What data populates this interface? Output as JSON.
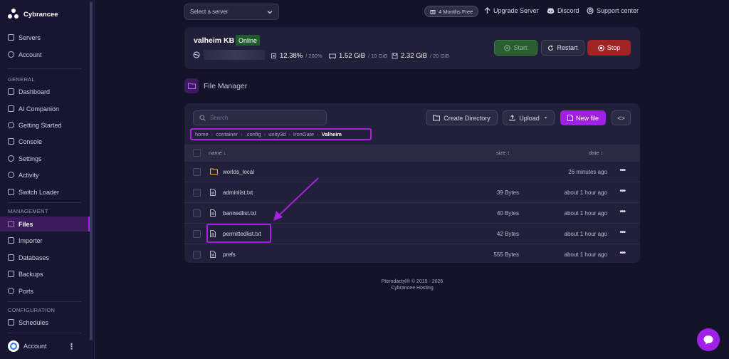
{
  "sidebar": {
    "brand": "Cybrancee",
    "top_items": [
      {
        "label": "Servers",
        "icon": "servers-icon"
      },
      {
        "label": "Account",
        "icon": "account-icon"
      }
    ],
    "section_general": "GENERAL",
    "general_items": [
      {
        "label": "Dashboard",
        "icon": "dashboard-icon"
      },
      {
        "label": "AI Companion",
        "icon": "ai-icon"
      },
      {
        "label": "Getting Started",
        "icon": "getting-started-icon"
      },
      {
        "label": "Console",
        "icon": "console-icon"
      },
      {
        "label": "Settings",
        "icon": "settings-icon"
      },
      {
        "label": "Activity",
        "icon": "activity-icon"
      },
      {
        "label": "Switch Loader",
        "icon": "switch-icon"
      }
    ],
    "section_management": "MANAGEMENT",
    "management_items": [
      {
        "label": "Files",
        "icon": "folder-icon",
        "active": true
      },
      {
        "label": "Importer",
        "icon": "import-icon"
      },
      {
        "label": "Databases",
        "icon": "database-icon"
      },
      {
        "label": "Backups",
        "icon": "backup-icon"
      },
      {
        "label": "Ports",
        "icon": "ports-icon"
      }
    ],
    "section_configuration": "CONFIGURATION",
    "configuration_items": [
      {
        "label": "Schedules",
        "icon": "schedule-icon"
      }
    ],
    "bottom_account": "Account"
  },
  "topbar": {
    "server_select_placeholder": "Select a server",
    "promo": "4 Months Free",
    "upgrade": "Upgrade Server",
    "discord": "Discord",
    "support": "Support center"
  },
  "server": {
    "name": "valheim KB",
    "status": "Online",
    "cpu": "12.38%",
    "cpu_limit": "/ 200%",
    "memory": "1.52 GiB",
    "memory_limit": "/ 10 GiB",
    "disk": "2.32 GiB",
    "disk_limit": "/ 20 GiB",
    "start": "Start",
    "restart": "Restart",
    "stop": "Stop"
  },
  "file_manager": {
    "title": "File Manager",
    "search_placeholder": "Search",
    "create_directory": "Create Directory",
    "upload": "Upload",
    "new_file": "New file",
    "code_button": "<>",
    "breadcrumbs": [
      "home",
      "container",
      ".config",
      "unity3d",
      "IronGate",
      "Valheim"
    ],
    "columns": {
      "name": "name ↓",
      "size": "size ↕",
      "date": "date ↕"
    },
    "files": [
      {
        "name": "worlds_local",
        "type": "folder",
        "size": "",
        "date": "26 minutes ago"
      },
      {
        "name": "adminlist.txt",
        "type": "file",
        "size": "39 Bytes",
        "date": "about 1 hour ago"
      },
      {
        "name": "bannedlist.txt",
        "type": "file",
        "size": "40 Bytes",
        "date": "about 1 hour ago"
      },
      {
        "name": "permittedlist.txt",
        "type": "file",
        "size": "42 Bytes",
        "date": "about 1 hour ago"
      },
      {
        "name": "prefs",
        "type": "file",
        "size": "555 Bytes",
        "date": "about 1 hour ago"
      }
    ]
  },
  "footer": {
    "line1": "Pterodactyl® © 2015 - 2026",
    "line2": "Cybrancee Hosting"
  },
  "colors": {
    "accent": "#a020e8",
    "online": "#1f5a2c",
    "stop": "#a02424"
  }
}
